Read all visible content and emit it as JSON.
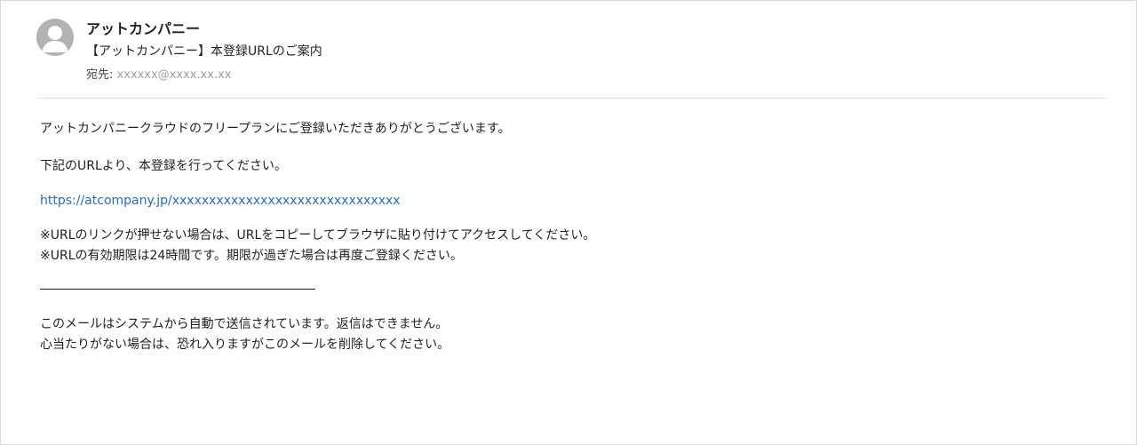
{
  "email": {
    "sender_name": "アットカンパニー",
    "subject": "【アットカンパニー】本登録URLのご案内",
    "recipient_label": "宛先: ",
    "recipient_address": "xxxxxx@xxxx.xx.xx"
  },
  "body": {
    "greeting": "アットカンパニークラウドのフリープランにご登録いただきありがとうございます。",
    "instruction": "下記のURLより、本登録を行ってください。",
    "url": "https://atcompany.jp/xxxxxxxxxxxxxxxxxxxxxxxxxxxxxxx",
    "note_1": "※URLのリンクが押せない場合は、URLをコピーしてブラウザに貼り付けてアクセスしてください。",
    "note_2": "※URLの有効期限は24時間です。期限が過ぎた場合は再度ご登録ください。",
    "footer_1": "このメールはシステムから自動で送信されています。返信はできません。",
    "footer_2": "心当たりがない場合は、恐れ入りますがこのメールを削除してください。"
  },
  "colors": {
    "link": "#2a6db5",
    "avatar_bg": "#b3b3b3",
    "muted": "#9e9e9e"
  },
  "icons": {
    "avatar": "person-avatar-icon"
  }
}
